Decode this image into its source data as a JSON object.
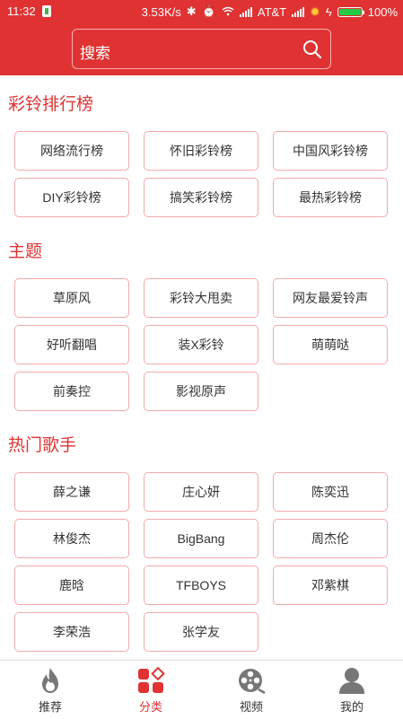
{
  "status_bar": {
    "time": "11:32",
    "network_speed": "3.53K/s",
    "carrier": "AT&T",
    "battery": "100%"
  },
  "search": {
    "placeholder": "搜索"
  },
  "sections": [
    {
      "title": "彩铃排行榜",
      "tags": [
        "网络流行榜",
        "怀旧彩铃榜",
        "中国风彩铃榜",
        "DIY彩铃榜",
        "搞笑彩铃榜",
        "最热彩铃榜"
      ]
    },
    {
      "title": "主题",
      "tags": [
        "草原风",
        "彩铃大甩卖",
        "网友最爱铃声",
        "好听翻唱",
        "装X彩铃",
        "萌萌哒",
        "前奏控",
        "影视原声"
      ]
    },
    {
      "title": "热门歌手",
      "tags": [
        "薛之谦",
        "庄心妍",
        "陈奕迅",
        "林俊杰",
        "BigBang",
        "周杰伦",
        "鹿晗",
        "TFBOYS",
        "邓紫棋",
        "李荣浩",
        "张学友"
      ]
    }
  ],
  "bottom_nav": [
    {
      "label": "推荐",
      "icon": "flame-icon",
      "active": false
    },
    {
      "label": "分类",
      "icon": "category-icon",
      "active": true
    },
    {
      "label": "视频",
      "icon": "film-reel-icon",
      "active": false
    },
    {
      "label": "我的",
      "icon": "user-icon",
      "active": false
    }
  ],
  "colors": {
    "accent": "#e03232",
    "tag_border": "#f2aaaa",
    "nav_inactive": "#777777"
  }
}
